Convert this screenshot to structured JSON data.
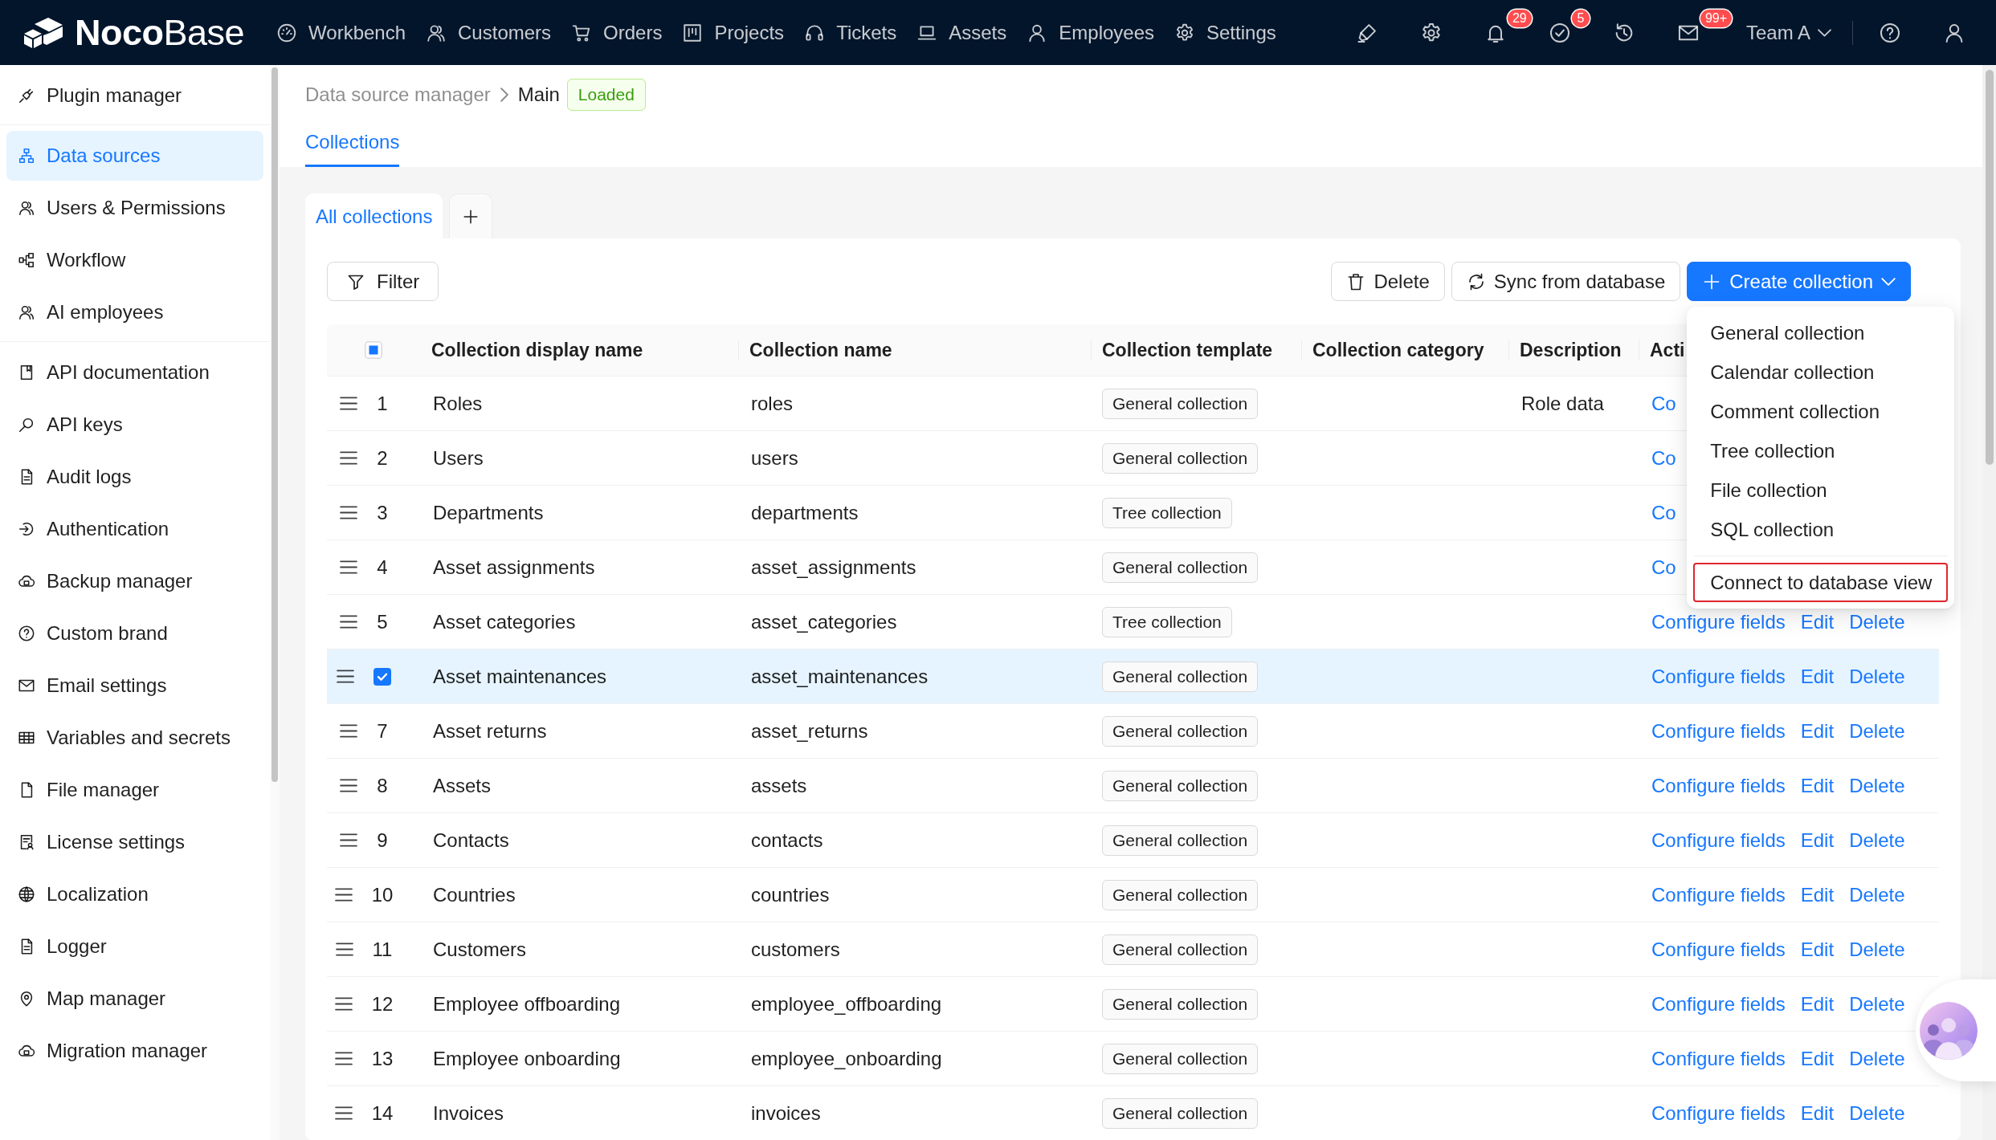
{
  "top_bar": {
    "logo": "**Noco**Base",
    "nav": [
      {
        "label": "Workbench"
      },
      {
        "label": "Customers"
      },
      {
        "label": "Orders"
      },
      {
        "label": "Projects"
      },
      {
        "label": "Tickets"
      },
      {
        "label": "Assets"
      },
      {
        "label": "Employees"
      },
      {
        "label": "Settings"
      }
    ],
    "bell_badge": "29",
    "tasks_badge": "5",
    "messages_badge": "99+",
    "team": "Team A"
  },
  "sidebar": {
    "groups": [
      {
        "items": [
          {
            "label": "Plugin manager",
            "selected": false
          }
        ]
      },
      {
        "items": [
          {
            "label": "Data sources",
            "selected": true
          },
          {
            "label": "Users & Permissions",
            "selected": false
          },
          {
            "label": "Workflow",
            "selected": false
          },
          {
            "label": "AI employees",
            "selected": false
          }
        ]
      },
      {
        "items": [
          {
            "label": "API documentation",
            "selected": false
          },
          {
            "label": "API keys",
            "selected": false
          },
          {
            "label": "Audit logs",
            "selected": false
          },
          {
            "label": "Authentication",
            "selected": false
          },
          {
            "label": "Backup manager",
            "selected": false
          },
          {
            "label": "Custom brand",
            "selected": false
          },
          {
            "label": "Email settings",
            "selected": false
          },
          {
            "label": "Variables and secrets",
            "selected": false
          },
          {
            "label": "File manager",
            "selected": false
          },
          {
            "label": "License settings",
            "selected": false
          },
          {
            "label": "Localization",
            "selected": false
          },
          {
            "label": "Logger",
            "selected": false
          },
          {
            "label": "Map manager",
            "selected": false
          },
          {
            "label": "Migration manager",
            "selected": false
          }
        ]
      }
    ]
  },
  "breadcrumb": {
    "items": [
      "Data source manager",
      "Main"
    ],
    "status_tag": "Loaded"
  },
  "tabs": [
    {
      "label": "Collections",
      "selected": true
    }
  ],
  "collection_tabs": [
    {
      "label": "All collections",
      "selected": true
    }
  ],
  "toolbar": {
    "filter": "Filter",
    "buttons": [
      {
        "label": "Delete",
        "kind": "default"
      },
      {
        "label": "Sync from database",
        "kind": "default"
      },
      {
        "label": "Create collection",
        "kind": "primary",
        "expanded": true,
        "menu": {
          "groups": [
            {
              "items": [
                {
                  "label": "General collection",
                  "highlighted": false
                },
                {
                  "label": "Calendar collection",
                  "highlighted": false
                },
                {
                  "label": "Comment collection",
                  "highlighted": false
                },
                {
                  "label": "Tree collection",
                  "highlighted": false
                },
                {
                  "label": "File collection",
                  "highlighted": false
                },
                {
                  "label": "SQL collection",
                  "highlighted": false
                }
              ]
            },
            {
              "items": [
                {
                  "label": "Connect to database view",
                  "highlighted": true
                }
              ]
            }
          ]
        }
      }
    ]
  },
  "table": {
    "select_all_checked": false,
    "select_all_indeterminate": true,
    "columns": [
      "Collection display name",
      "Collection name",
      "Collection template",
      "Collection category",
      "Description",
      "Acti"
    ],
    "rows": [
      {
        "index": "1",
        "selected": false,
        "display_name": "Roles",
        "name": "roles",
        "template": "General collection",
        "description": "Role data",
        "actions": [
          "Co"
        ]
      },
      {
        "index": "2",
        "selected": false,
        "display_name": "Users",
        "name": "users",
        "template": "General collection",
        "actions": [
          "Co"
        ]
      },
      {
        "index": "3",
        "selected": false,
        "display_name": "Departments",
        "name": "departments",
        "template": "Tree collection",
        "actions": [
          "Co"
        ]
      },
      {
        "index": "4",
        "selected": false,
        "display_name": "Asset assignments",
        "name": "asset_assignments",
        "template": "General collection",
        "actions": [
          "Co"
        ]
      },
      {
        "index": "5",
        "selected": false,
        "display_name": "Asset categories",
        "name": "asset_categories",
        "template": "Tree collection",
        "actions": [
          "Configure fields",
          "Edit",
          "Delete"
        ]
      },
      {
        "selected": true,
        "display_name": "Asset maintenances",
        "name": "asset_maintenances",
        "template": "General collection",
        "actions": [
          "Configure fields",
          "Edit",
          "Delete"
        ]
      },
      {
        "index": "7",
        "selected": false,
        "display_name": "Asset returns",
        "name": "asset_returns",
        "template": "General collection",
        "actions": [
          "Configure fields",
          "Edit",
          "Delete"
        ]
      },
      {
        "index": "8",
        "selected": false,
        "display_name": "Assets",
        "name": "assets",
        "template": "General collection",
        "actions": [
          "Configure fields",
          "Edit",
          "Delete"
        ]
      },
      {
        "index": "9",
        "selected": false,
        "display_name": "Contacts",
        "name": "contacts",
        "template": "General collection",
        "actions": [
          "Configure fields",
          "Edit",
          "Delete"
        ]
      },
      {
        "index": "10",
        "selected": false,
        "display_name": "Countries",
        "name": "countries",
        "template": "General collection",
        "actions": [
          "Configure fields",
          "Edit",
          "Delete"
        ]
      },
      {
        "index": "11",
        "selected": false,
        "display_name": "Customers",
        "name": "customers",
        "template": "General collection",
        "actions": [
          "Configure fields",
          "Edit",
          "Delete"
        ]
      },
      {
        "index": "12",
        "selected": false,
        "display_name": "Employee offboarding",
        "name": "employee_offboarding",
        "template": "General collection",
        "actions": [
          "Configure fields",
          "Edit",
          "Delete"
        ]
      },
      {
        "index": "13",
        "selected": false,
        "display_name": "Employee onboarding",
        "name": "employee_onboarding",
        "template": "General collection",
        "actions": [
          "Configure fields",
          "Edit",
          "Delete"
        ]
      },
      {
        "index": "14",
        "selected": false,
        "display_name": "Invoices",
        "name": "invoices",
        "template": "General collection",
        "actions": [
          "Configure fields",
          "Edit",
          "Delete"
        ]
      }
    ]
  }
}
